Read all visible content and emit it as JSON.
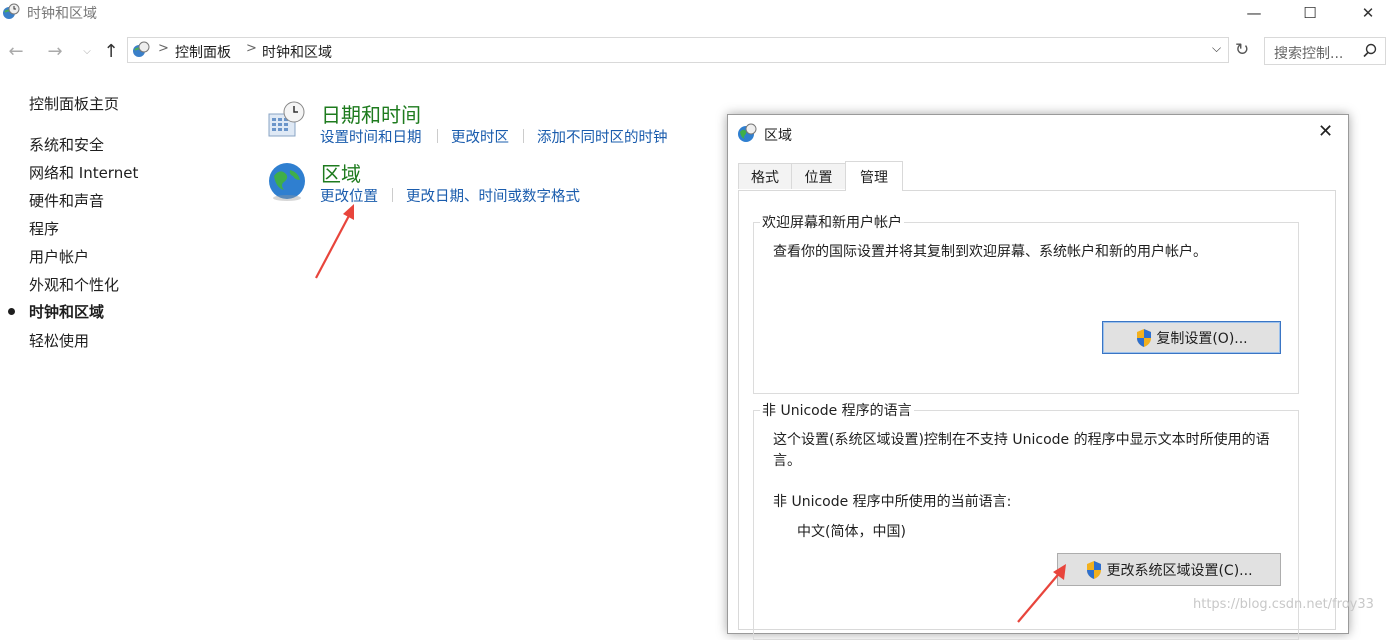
{
  "window": {
    "title": "时钟和区域"
  },
  "address": {
    "crumbs": [
      "控制面板",
      "时钟和区域"
    ],
    "search_placeholder": "搜索控制..."
  },
  "sidebar": {
    "home": "控制面板主页",
    "items": [
      {
        "label": "系统和安全"
      },
      {
        "label": "网络和 Internet"
      },
      {
        "label": "硬件和声音"
      },
      {
        "label": "程序"
      },
      {
        "label": "用户帐户"
      },
      {
        "label": "外观和个性化"
      },
      {
        "label": "时钟和区域",
        "current": true
      },
      {
        "label": "轻松使用"
      }
    ]
  },
  "categories": {
    "datetime": {
      "title": "日期和时间",
      "links": [
        "设置时间和日期",
        "更改时区",
        "添加不同时区的时钟"
      ]
    },
    "region": {
      "title": "区域",
      "links": [
        "更改位置",
        "更改日期、时间或数字格式"
      ]
    }
  },
  "dialog": {
    "title": "区域",
    "tabs": [
      "格式",
      "位置",
      "管理"
    ],
    "active_tab": "管理",
    "welcome_group": {
      "label": "欢迎屏幕和新用户帐户",
      "text": "查看你的国际设置并将其复制到欢迎屏幕、系统帐户和新的用户帐户。",
      "button": "复制设置(O)..."
    },
    "unicode_group": {
      "label": "非 Unicode 程序的语言",
      "text": "这个设置(系统区域设置)控制在不支持 Unicode 的程序中显示文本时所使用的语言。",
      "current_label": "非 Unicode 程序中所使用的当前语言:",
      "current_value": "中文(简体，中国)",
      "button": "更改系统区域设置(C)..."
    }
  },
  "watermark": "https://blog.csdn.net/froy33",
  "colors": {
    "link": "#1a5cad",
    "category_title": "#1e7b1e",
    "arrow": "#e8453c"
  }
}
